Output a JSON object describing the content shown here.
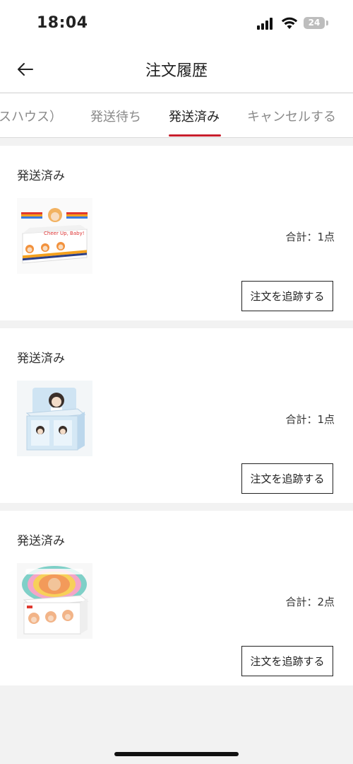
{
  "status_bar": {
    "time": "18:04",
    "battery": "24"
  },
  "header": {
    "title": "注文履歴"
  },
  "tabs": [
    {
      "label": "スハウス）"
    },
    {
      "label": "発送待ち"
    },
    {
      "label": "発送済み"
    },
    {
      "label": "キャンセルする"
    }
  ],
  "active_tab": "発送済み",
  "orders": [
    {
      "status": "発送済み",
      "total_label": "合計：1点",
      "action": "注文を追跡する",
      "product_text": "Cheer Up, Baby!"
    },
    {
      "status": "発送済み",
      "total_label": "合計：1点",
      "action": "注文を追跡する"
    },
    {
      "status": "発送済み",
      "total_label": "合計：2点",
      "action": "注文を追跡する"
    }
  ],
  "colors": {
    "accent": "#c81e2c",
    "background": "#f2f2f2"
  }
}
